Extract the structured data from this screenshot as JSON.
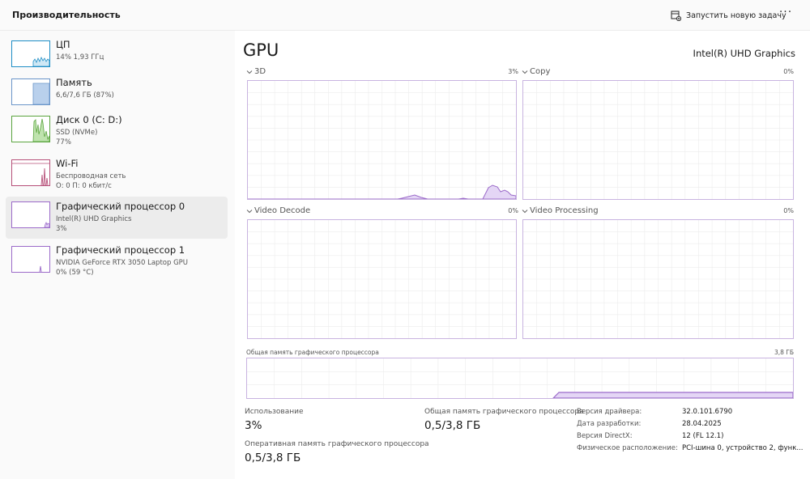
{
  "header": {
    "title": "Производительность",
    "run_task_label": "Запустить новую задачу",
    "more_label": "···"
  },
  "sidebar": {
    "items": [
      {
        "title": "ЦП",
        "sub1": "14% 1,93 ГГц",
        "sub2": "",
        "color": "#1e8ec6"
      },
      {
        "title": "Память",
        "sub1": "6,6/7,6 ГБ (87%)",
        "sub2": "",
        "color": "#6a95c9"
      },
      {
        "title": "Диск 0 (C: D:)",
        "sub1": "SSD (NVMe)",
        "sub2": "77%",
        "color": "#5aa43e"
      },
      {
        "title": "Wi-Fi",
        "sub1": "Беспроводная сеть",
        "sub2": "О: 0 П: 0 кбит/с",
        "color": "#b64f78"
      },
      {
        "title": "Графический процессор 0",
        "sub1": "Intel(R) UHD Graphics",
        "sub2": "3%",
        "color": "#9b6ac9"
      },
      {
        "title": "Графический процессор 1",
        "sub1": "NVIDIA GeForce RTX 3050 Laptop GPU",
        "sub2": "0% (59 °C)",
        "color": "#9b6ac9"
      }
    ],
    "selected_index": 4
  },
  "main": {
    "title": "GPU",
    "device_name": "Intel(R) UHD Graphics",
    "engines": [
      {
        "label": "3D",
        "percent": "3%"
      },
      {
        "label": "Copy",
        "percent": "0%"
      },
      {
        "label": "Video Decode",
        "percent": "0%"
      },
      {
        "label": "Video Processing",
        "percent": "0%"
      }
    ],
    "shared_memory": {
      "label": "Общая память графического процессора",
      "max": "3,8 ГБ"
    },
    "stats": {
      "usage_label": "Использование",
      "usage_value": "3%",
      "shared_label": "Общая память графического процессора",
      "shared_value": "0,5/3,8 ГБ",
      "dedicated_label": "Оперативная память графического процессора",
      "dedicated_value": "0,5/3,8 ГБ"
    },
    "info": [
      {
        "label": "Версия драйвера:",
        "value": "32.0.101.6790"
      },
      {
        "label": "Дата разработки:",
        "value": "28.04.2025"
      },
      {
        "label": "Версия DirectX:",
        "value": "12 (FL 12.1)"
      },
      {
        "label": "Физическое расположение:",
        "value": "PCI-шина 0, устройство 2, функ..."
      }
    ]
  },
  "colors": {
    "gpu_line": "#9b6ac9",
    "gpu_fill": "#e4d6f5",
    "grid": "#ececec",
    "border": "#c8b3e0"
  }
}
